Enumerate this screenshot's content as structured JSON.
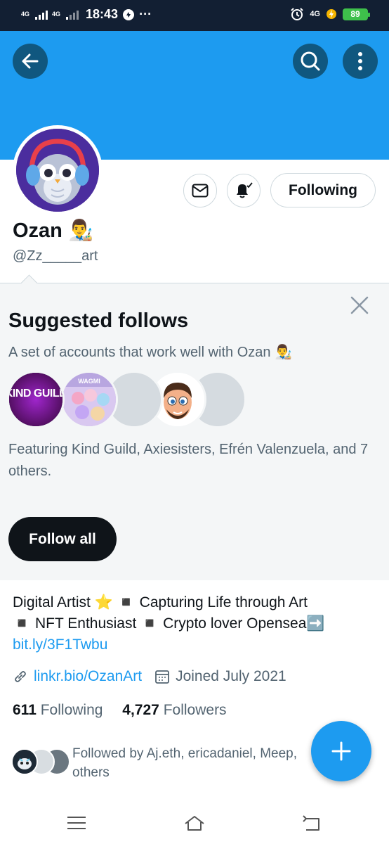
{
  "status_bar": {
    "network1": "4G",
    "network2": "4G",
    "time": "18:43",
    "more": "···",
    "network_right": "4G",
    "battery": "89"
  },
  "profile": {
    "name": "Ozan 👨‍🎨",
    "handle": "@Zz_____art",
    "following_button": "Following"
  },
  "suggested": {
    "title": "Suggested follows",
    "subtitle": "A set of accounts that work well with Ozan 👨‍🎨",
    "avatar_kind_guild": "KIND GUILD",
    "avatar_wagmi": "WAGMI",
    "featuring": "Featuring Kind Guild, Axiesisters, Efrén Valenzuela, and 7 others.",
    "follow_all": "Follow all"
  },
  "bio": {
    "line1": "Digital Artist ⭐ ◾ Capturing Life through Art",
    "line2": "◾ NFT Enthusiast ◾ Crypto lover Opensea➡️",
    "link": "bit.ly/3F1Twbu"
  },
  "meta": {
    "website": "linkr.bio/OzanArt",
    "joined": "Joined July 2021"
  },
  "counts": {
    "following_num": "611",
    "following_label": "Following",
    "followers_num": "4,727",
    "followers_label": "Followers"
  },
  "followed_by": {
    "text": "Followed by Aj.eth, ericadaniel, Meep,",
    "text2": "others"
  },
  "colors": {
    "accent": "#1d9bf0",
    "banner": "#1d9bf0",
    "status_bar": "#121f33"
  }
}
